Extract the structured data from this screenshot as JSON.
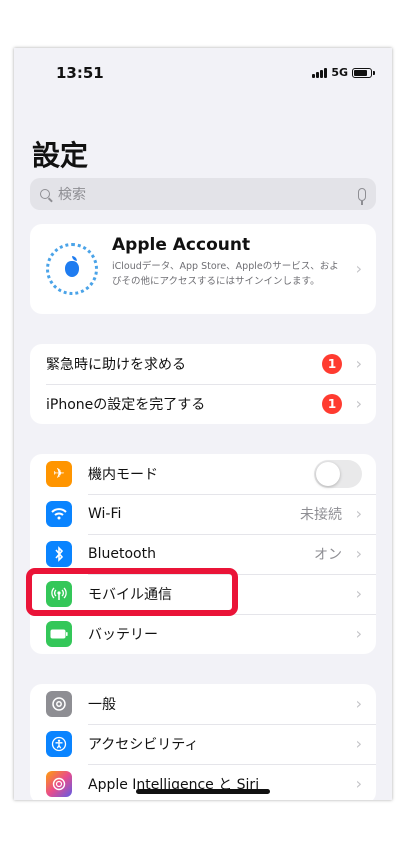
{
  "status_bar": {
    "time": "13:51",
    "network": "5G"
  },
  "page_title": "設定",
  "search": {
    "placeholder": "検索"
  },
  "account": {
    "title": "Apple Account",
    "description": "iCloudデータ、App Store、Appleのサービス、およびその他にアクセスするにはサインインします。"
  },
  "alerts": [
    {
      "label": "緊急時に助けを求める",
      "badge": "1"
    },
    {
      "label": "iPhoneの設定を完了する",
      "badge": "1"
    }
  ],
  "connectivity": [
    {
      "label": "機内モード",
      "icon": "airplane-icon",
      "color": "#ff9500",
      "toggle_on": false
    },
    {
      "label": "Wi-Fi",
      "icon": "wifi-icon",
      "color": "#0a84ff",
      "value": "未接続"
    },
    {
      "label": "Bluetooth",
      "icon": "bluetooth-icon",
      "color": "#0a84ff",
      "value": "オン"
    },
    {
      "label": "モバイル通信",
      "icon": "antenna-icon",
      "color": "#34c759"
    },
    {
      "label": "バッテリー",
      "icon": "battery-icon",
      "color": "#34c759"
    }
  ],
  "general": [
    {
      "label": "一般",
      "icon": "gear-icon",
      "color": "#8e8e93"
    },
    {
      "label": "アクセシビリティ",
      "icon": "accessibility-icon",
      "color": "#0a84ff"
    },
    {
      "label": "Apple Intelligence と Siri",
      "icon": "siri-icon",
      "color": "#e84c8c"
    }
  ],
  "highlight_color": "#ea1438"
}
